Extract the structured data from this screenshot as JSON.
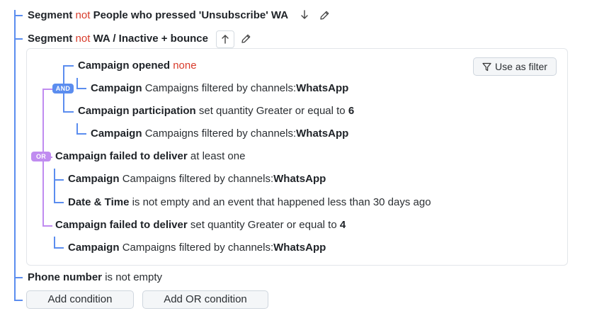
{
  "segment1": {
    "label": "Segment",
    "negation": "not",
    "name": "People who pressed 'Unsubscribe' WA"
  },
  "segment2": {
    "label": "Segment",
    "negation": "not",
    "name": "WA / Inactive + bounce"
  },
  "use_as_filter": "Use as filter",
  "and_badge": "AND",
  "or_badge": "OR",
  "conditions": {
    "campaign_opened": {
      "title": "Campaign opened",
      "value": "none"
    },
    "campaign_wa_1": {
      "title": "Campaign",
      "text": "Campaigns filtered by channels:",
      "value": "WhatsApp"
    },
    "campaign_participation": {
      "title": "Campaign participation",
      "text": "set quantity Greater or equal to",
      "value": "6"
    },
    "campaign_wa_2": {
      "title": "Campaign",
      "text": "Campaigns filtered by channels:",
      "value": "WhatsApp"
    },
    "failed_deliver_1": {
      "title": "Campaign failed to deliver",
      "text": "at least one"
    },
    "campaign_wa_3": {
      "title": "Campaign",
      "text": "Campaigns filtered by channels:",
      "value": "WhatsApp"
    },
    "date_time": {
      "title": "Date & Time",
      "text": "is not empty and an event that happened less than 30 days ago"
    },
    "failed_deliver_2": {
      "title": "Campaign failed to deliver",
      "text": "set quantity Greater or equal to",
      "value": "4"
    },
    "campaign_wa_4": {
      "title": "Campaign",
      "text": "Campaigns filtered by channels:",
      "value": "WhatsApp"
    }
  },
  "phone": {
    "title": "Phone number",
    "text": "is not empty"
  },
  "buttons": {
    "add_condition": "Add condition",
    "add_or_condition": "Add OR condition"
  },
  "icons": {
    "down_arrow": "arrow-down-icon",
    "up_arrow": "arrow-up-icon",
    "edit": "pencil-icon",
    "filter": "funnel-icon"
  },
  "colors": {
    "tree_line": "#5b8def",
    "or_line": "#c08cf0",
    "negation": "#d83b2b"
  }
}
